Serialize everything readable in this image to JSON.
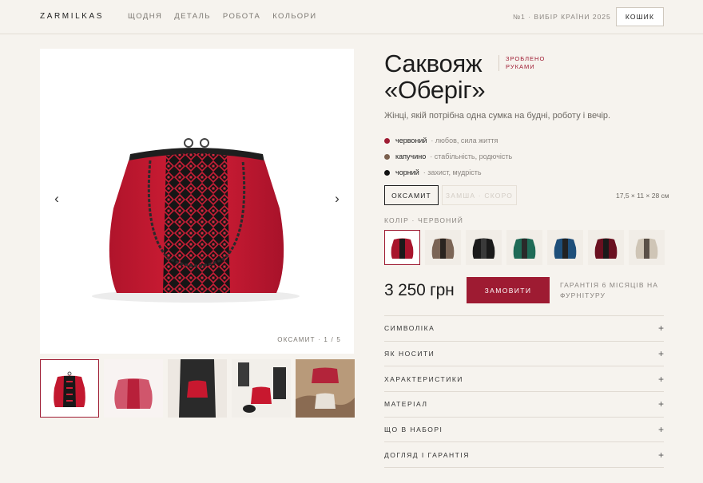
{
  "header": {
    "logo": "ZARMILKAS",
    "nav": [
      "ЩОДНЯ",
      "ДЕТАЛЬ",
      "РОБОТА",
      "КОЛЬОРИ"
    ],
    "choice": "№1 · ВИБІР КРАЇНИ 2025",
    "cart_label": "КОШИК"
  },
  "gallery": {
    "prev_arrow": "‹",
    "next_arrow": "›",
    "counter": "ОКСАМИТ · 1 / 5",
    "thumbnail_count": 5
  },
  "product": {
    "title_line1": "Саквояж",
    "title_line2": "«Оберіг»",
    "handmade_line1": "ЗРОБЛЕНО",
    "handmade_line2": "РУКАМИ",
    "subtitle": "Жінці, якій потрібна одна сумка на будні, роботу і вечір.",
    "symbolism": [
      {
        "name": "червоний",
        "meaning": "· любов, сила життя",
        "color": "#9e1b32"
      },
      {
        "name": "капучино",
        "meaning": "· стабільність, родючість",
        "color": "#7a5f4d"
      },
      {
        "name": "чорний",
        "meaning": "· захист, мудрість",
        "color": "#111111"
      }
    ],
    "materials": [
      {
        "label": "ОКСАМИТ",
        "selected": true
      },
      {
        "label": "ЗАМША · СКОРО",
        "selected": false,
        "disabled": true
      }
    ],
    "dimensions": "17,5 × 11 × 28 см",
    "color_label": "КОЛІР · ЧЕРВОНИЙ",
    "swatch_colors": [
      "#a8142c",
      "#7b6556",
      "#1a1a1a",
      "#1f6b57",
      "#1e4f7a",
      "#6a1020",
      "#cfc5b6"
    ],
    "price": "3 250 грн",
    "order_label": "ЗАМОВИТИ",
    "warranty": "ГАРАНТІЯ 6 МІСЯЦІВ НА ФУРНІТУРУ",
    "accordion": [
      "СИМВОЛІКА",
      "ЯК НОСИТИ",
      "ХАРАКТЕРИСТИКИ",
      "МАТЕРІАЛ",
      "ЩО В НАБОРІ",
      "ДОГЛЯД І ГАРАНТІЯ"
    ]
  },
  "colors": {
    "accent": "#9e1b32",
    "background": "#f6f3ee"
  }
}
